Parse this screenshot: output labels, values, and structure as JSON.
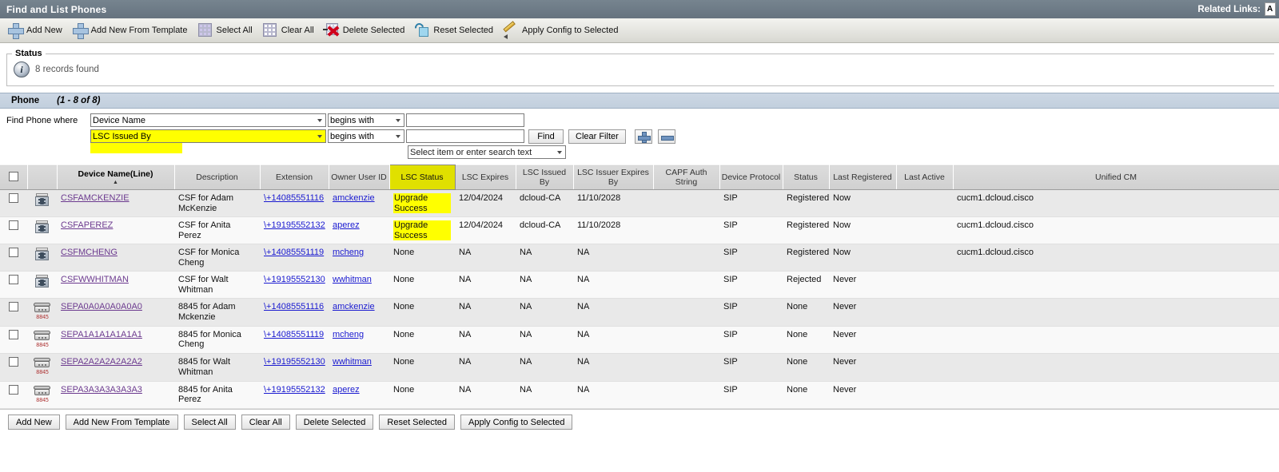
{
  "window": {
    "title": "Find and List Phones",
    "related_links_label": "Related Links:",
    "related_links_value": "A"
  },
  "toolbar": {
    "items": [
      {
        "label": "Add New",
        "icon": "plus-icon"
      },
      {
        "label": "Add New From Template",
        "icon": "plus-icon"
      },
      {
        "label": "Select All",
        "icon": "grid-filled-icon"
      },
      {
        "label": "Clear All",
        "icon": "grid-empty-icon"
      },
      {
        "label": "Delete Selected",
        "icon": "delete-x-icon"
      },
      {
        "label": "Reset Selected",
        "icon": "reset-cube-icon"
      },
      {
        "label": "Apply Config to Selected",
        "icon": "pencil-icon"
      }
    ]
  },
  "status": {
    "legend": "Status",
    "icon": "info-icon",
    "message": "8 records found"
  },
  "section": {
    "title": "Phone",
    "count": "(1 - 8 of 8)"
  },
  "filters": {
    "label": "Find Phone where",
    "row1": {
      "field": "Device Name",
      "operator": "begins with",
      "value": "",
      "placeholder": ""
    },
    "row2": {
      "field": "LSC Issued By",
      "operator": "begins with",
      "value": "",
      "placeholder": ""
    },
    "find_button": "Find",
    "clear_filter_button": "Clear Filter",
    "add_row_button": "+",
    "remove_row_button": "-",
    "search_select": "Select item or enter search text",
    "highlight_color": "#ffff00"
  },
  "table": {
    "headers": [
      {
        "label": "",
        "key": "checkbox"
      },
      {
        "label": "",
        "key": "icon"
      },
      {
        "label": "Device Name(Line)",
        "key": "device_name",
        "sorted": "▲"
      },
      {
        "label": "Description",
        "key": "description"
      },
      {
        "label": "Extension",
        "key": "extension"
      },
      {
        "label": "Owner User ID",
        "key": "owner_user_id"
      },
      {
        "label": "LSC Status",
        "key": "lsc_status",
        "highlight": true
      },
      {
        "label": "LSC Expires",
        "key": "lsc_expires"
      },
      {
        "label": "LSC Issued By",
        "key": "lsc_issued_by"
      },
      {
        "label": "LSC Issuer Expires By",
        "key": "lsc_issuer_expires_by"
      },
      {
        "label": "CAPF Auth String",
        "key": "capf_auth_string"
      },
      {
        "label": "Device Protocol",
        "key": "device_protocol"
      },
      {
        "label": "Status",
        "key": "status"
      },
      {
        "label": "Last Registered",
        "key": "last_registered"
      },
      {
        "label": "Last Active",
        "key": "last_active"
      },
      {
        "label": "Unified CM",
        "key": "unified_cm"
      }
    ],
    "rows": [
      {
        "icon": "csf-softphone-icon",
        "device_name": "CSFAMCKENZIE",
        "description": "CSF for Adam McKenzie",
        "extension": "\\+14085551116",
        "owner_user_id": "amckenzie",
        "lsc_status": "Upgrade Success",
        "lsc_status_highlight": true,
        "lsc_expires": "12/04/2024",
        "lsc_issued_by": "dcloud-CA",
        "lsc_issuer_expires_by": "11/10/2028",
        "capf_auth_string": "",
        "device_protocol": "SIP",
        "status": "Registered",
        "last_registered": "Now",
        "last_active": "",
        "unified_cm": "cucm1.dcloud.cisco"
      },
      {
        "icon": "csf-softphone-icon",
        "device_name": "CSFAPEREZ",
        "description": "CSF for Anita Perez",
        "extension": "\\+19195552132",
        "owner_user_id": "aperez",
        "lsc_status": "Upgrade Success",
        "lsc_status_highlight": true,
        "lsc_expires": "12/04/2024",
        "lsc_issued_by": "dcloud-CA",
        "lsc_issuer_expires_by": "11/10/2028",
        "capf_auth_string": "",
        "device_protocol": "SIP",
        "status": "Registered",
        "last_registered": "Now",
        "last_active": "",
        "unified_cm": "cucm1.dcloud.cisco"
      },
      {
        "icon": "csf-softphone-icon",
        "device_name": "CSFMCHENG",
        "description": "CSF for Monica Cheng",
        "extension": "\\+14085551119",
        "owner_user_id": "mcheng",
        "lsc_status": "None",
        "lsc_status_highlight": false,
        "lsc_expires": "NA",
        "lsc_issued_by": "NA",
        "lsc_issuer_expires_by": "NA",
        "capf_auth_string": "",
        "device_protocol": "SIP",
        "status": "Registered",
        "last_registered": "Now",
        "last_active": "",
        "unified_cm": "cucm1.dcloud.cisco"
      },
      {
        "icon": "csf-softphone-icon",
        "device_name": "CSFWWHITMAN",
        "description": "CSF for Walt Whitman",
        "extension": "\\+19195552130",
        "owner_user_id": "wwhitman",
        "lsc_status": "None",
        "lsc_status_highlight": false,
        "lsc_expires": "NA",
        "lsc_issued_by": "NA",
        "lsc_issuer_expires_by": "NA",
        "capf_auth_string": "",
        "device_protocol": "SIP",
        "status": "Rejected",
        "last_registered": "Never",
        "last_active": "",
        "unified_cm": ""
      },
      {
        "icon": "desk-phone-8845-icon",
        "device_name": "SEPA0A0A0A0A0A0",
        "description": "8845 for Adam Mckenzie",
        "extension": "\\+14085551116",
        "owner_user_id": "amckenzie",
        "lsc_status": "None",
        "lsc_status_highlight": false,
        "lsc_expires": "NA",
        "lsc_issued_by": "NA",
        "lsc_issuer_expires_by": "NA",
        "capf_auth_string": "",
        "device_protocol": "SIP",
        "status": "None",
        "last_registered": "Never",
        "last_active": "",
        "unified_cm": ""
      },
      {
        "icon": "desk-phone-8845-icon",
        "device_name": "SEPA1A1A1A1A1A1",
        "description": "8845 for Monica Cheng",
        "extension": "\\+14085551119",
        "owner_user_id": "mcheng",
        "lsc_status": "None",
        "lsc_status_highlight": false,
        "lsc_expires": "NA",
        "lsc_issued_by": "NA",
        "lsc_issuer_expires_by": "NA",
        "capf_auth_string": "",
        "device_protocol": "SIP",
        "status": "None",
        "last_registered": "Never",
        "last_active": "",
        "unified_cm": ""
      },
      {
        "icon": "desk-phone-8845-icon",
        "device_name": "SEPA2A2A2A2A2A2",
        "description": "8845 for Walt Whitman",
        "extension": "\\+19195552130",
        "owner_user_id": "wwhitman",
        "lsc_status": "None",
        "lsc_status_highlight": false,
        "lsc_expires": "NA",
        "lsc_issued_by": "NA",
        "lsc_issuer_expires_by": "NA",
        "capf_auth_string": "",
        "device_protocol": "SIP",
        "status": "None",
        "last_registered": "Never",
        "last_active": "",
        "unified_cm": ""
      },
      {
        "icon": "desk-phone-8845-icon",
        "device_name": "SEPA3A3A3A3A3A3",
        "description": "8845 for Anita Perez",
        "extension": "\\+19195552132",
        "owner_user_id": "aperez",
        "lsc_status": "None",
        "lsc_status_highlight": false,
        "lsc_expires": "NA",
        "lsc_issued_by": "NA",
        "lsc_issuer_expires_by": "NA",
        "capf_auth_string": "",
        "device_protocol": "SIP",
        "status": "None",
        "last_registered": "Never",
        "last_active": "",
        "unified_cm": ""
      }
    ]
  },
  "bottom_buttons": [
    "Add New",
    "Add New From Template",
    "Select All",
    "Clear All",
    "Delete Selected",
    "Reset Selected",
    "Apply Config to Selected"
  ]
}
